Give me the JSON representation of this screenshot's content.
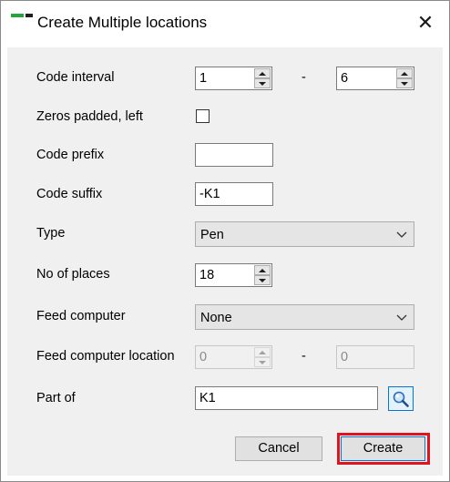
{
  "window": {
    "title": "Create Multiple locations",
    "close_glyph": "✕"
  },
  "form": {
    "code_interval": {
      "label": "Code interval",
      "from": "1",
      "separator": "-",
      "to": "6"
    },
    "zeros_padded": {
      "label": "Zeros padded, left",
      "checked": false
    },
    "code_prefix": {
      "label": "Code prefix",
      "value": ""
    },
    "code_suffix": {
      "label": "Code suffix",
      "value": "-K1"
    },
    "type": {
      "label": "Type",
      "value": "Pen"
    },
    "no_of_places": {
      "label": "No of places",
      "value": "18"
    },
    "feed_computer": {
      "label": "Feed computer",
      "value": "None"
    },
    "feed_computer_location": {
      "label": "Feed computer location",
      "from": "0",
      "separator": "-",
      "to": "0",
      "enabled": false
    },
    "part_of": {
      "label": "Part of",
      "value": "K1"
    }
  },
  "buttons": {
    "cancel": "Cancel",
    "create": "Create"
  },
  "icons": {
    "app": "app-icon",
    "close": "close-icon",
    "search": "magnifier-icon",
    "dropdown": "chevron-down-icon"
  },
  "colors": {
    "panel": "#f0f0f0",
    "accent": "#0078d7",
    "highlight": "#e0141e",
    "app_icon_green": "#22a83a"
  }
}
